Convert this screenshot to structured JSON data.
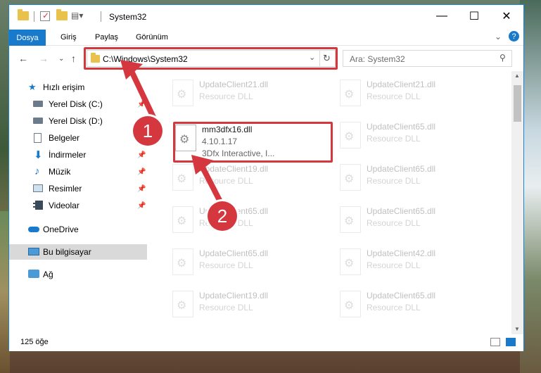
{
  "window": {
    "title": "System32",
    "controls": {
      "minimize": "—",
      "maximize": "☐",
      "close": "✕"
    }
  },
  "ribbon": {
    "tabs": [
      "Dosya",
      "Giriş",
      "Paylaş",
      "Görünüm"
    ],
    "expand_icon": "chevron-down",
    "help_icon": "?"
  },
  "address": {
    "path": "C:\\Windows\\System32",
    "search_placeholder": "Ara: System32"
  },
  "nav": {
    "items": [
      {
        "label": "Hızlı erişim",
        "icon": "star-icon",
        "pinned": false
      },
      {
        "label": "Yerel Disk (C:)",
        "icon": "drive-icon",
        "pinned": true
      },
      {
        "label": "Yerel Disk (D:)",
        "icon": "drive-icon",
        "pinned": true
      },
      {
        "label": "Belgeler",
        "icon": "document-icon",
        "pinned": true
      },
      {
        "label": "İndirmeler",
        "icon": "download-icon",
        "pinned": true
      },
      {
        "label": "Müzik",
        "icon": "music-icon",
        "pinned": true
      },
      {
        "label": "Resimler",
        "icon": "picture-icon",
        "pinned": true
      },
      {
        "label": "Videolar",
        "icon": "video-icon",
        "pinned": true
      },
      {
        "label": "OneDrive",
        "icon": "cloud-icon",
        "pinned": false
      },
      {
        "label": "Bu bilgisayar",
        "icon": "computer-icon",
        "pinned": false,
        "selected": true
      },
      {
        "label": "Ağ",
        "icon": "network-icon",
        "pinned": false
      }
    ]
  },
  "files": [
    {
      "name": "UpdateClient21.dll",
      "desc": "Resource DLL"
    },
    {
      "name": "UpdateClient21.dll",
      "desc": "Resource DLL"
    },
    {
      "name": "mm3dfx16.dll",
      "desc": "4.10.1.17",
      "desc2": "3Dfx Interactive, I...",
      "selected": true
    },
    {
      "name": "UpdateClient65.dll",
      "desc": "Resource DLL"
    },
    {
      "name": "UpdateClient19.dll",
      "desc": "Resource DLL"
    },
    {
      "name": "UpdateClient65.dll",
      "desc": "Resource DLL"
    },
    {
      "name": "UpdateClient65.dll",
      "desc": "Resource DLL"
    },
    {
      "name": "UpdateClient65.dll",
      "desc": "Resource DLL"
    },
    {
      "name": "UpdateClient65.dll",
      "desc": "Resource DLL"
    },
    {
      "name": "UpdateClient42.dll",
      "desc": "Resource DLL"
    },
    {
      "name": "UpdateClient19.dll",
      "desc": "Resource DLL"
    },
    {
      "name": "UpdateClient65.dll",
      "desc": "Resource DLL"
    }
  ],
  "status": {
    "count": "125 öğe"
  },
  "callouts": {
    "one": "1",
    "two": "2"
  },
  "colors": {
    "accent": "#1979ca",
    "highlight": "#d5373f",
    "folder": "#e8c24a"
  }
}
